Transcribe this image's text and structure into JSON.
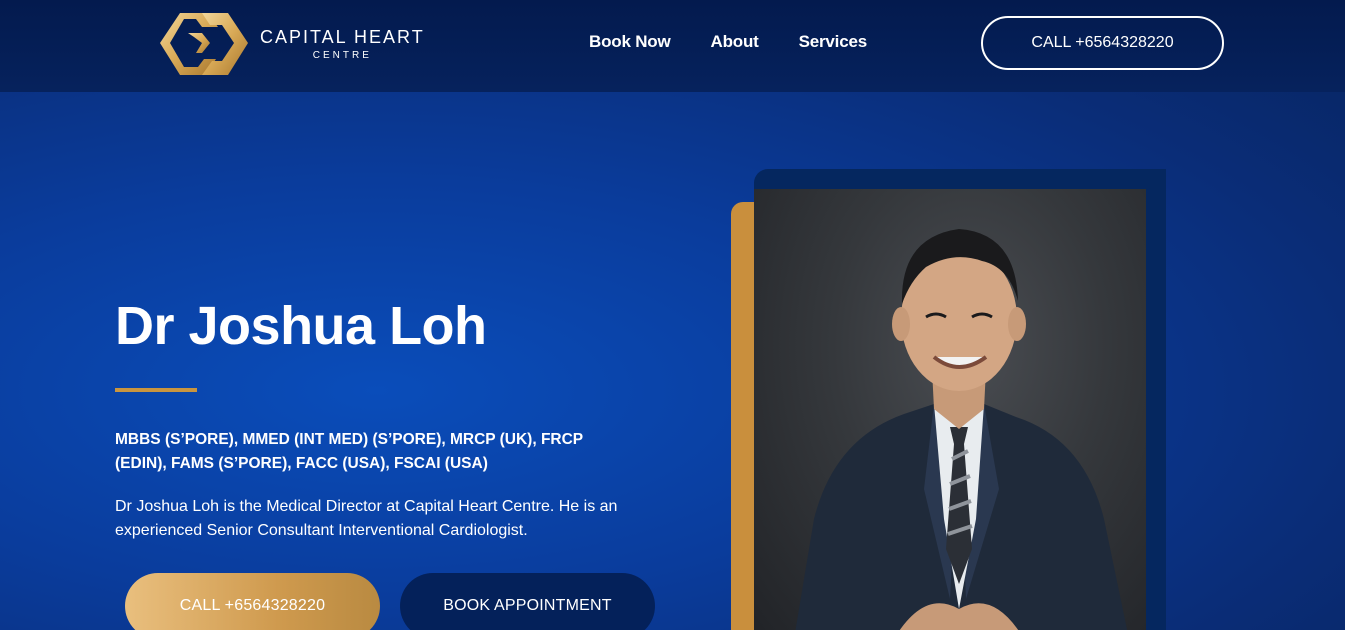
{
  "header": {
    "logo": {
      "name_line1": "CAPITAL HEART",
      "name_line2": "CENTRE",
      "icon": "capital-heart-logo-mark"
    },
    "nav": [
      {
        "label": "Book Now"
      },
      {
        "label": "About"
      },
      {
        "label": "Services"
      }
    ],
    "call_button": "CALL +6564328220"
  },
  "hero": {
    "title": "Dr Joshua Loh",
    "credentials": "MBBS (S’PORE), MMED (INT MED) (S’PORE), MRCP (UK), FRCP (EDIN), FAMS (S’PORE), FACC (USA), FSCAI (USA)",
    "bio": "Dr Joshua Loh is the Medical Director at Capital Heart Centre. He is an experienced Senior Consultant Interventional Cardiologist.",
    "call_button": "CALL +6564328220",
    "book_button": "BOOK APPOINTMENT"
  },
  "portrait": {
    "subject": "doctor-portrait"
  },
  "colors": {
    "navy_header": "#031a4e",
    "hero_blue": "#0a4dba",
    "gold_accent": "#c9953f",
    "dark_button": "#04215a"
  }
}
